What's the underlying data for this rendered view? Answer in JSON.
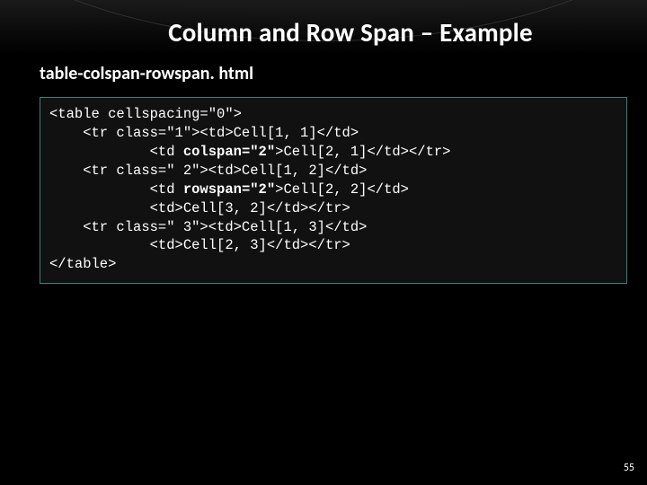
{
  "title": "Column and Row Span – Example",
  "subtitle": "table-colspan-rowspan. html",
  "code": {
    "l1": "<table cellspacing=\"0\">",
    "l2": "    <tr class=\"1\"><td>Cell[1, 1]</td>",
    "l3a": "            <td ",
    "l3b": "colspan=\"2\"",
    "l3c": ">Cell[2, 1]</td></tr>",
    "l4": "    <tr class=\" 2\"><td>Cell[1, 2]</td>",
    "l5a": "            <td ",
    "l5b": "rowspan=\"2\"",
    "l5c": ">Cell[2, 2]</td>",
    "l6": "            <td>Cell[3, 2]</td></tr>",
    "l7": "    <tr class=\" 3\"><td>Cell[1, 3]</td>",
    "l8": "            <td>Cell[2, 3]</td></tr>",
    "l9": "</table>"
  },
  "pagenum": "55"
}
